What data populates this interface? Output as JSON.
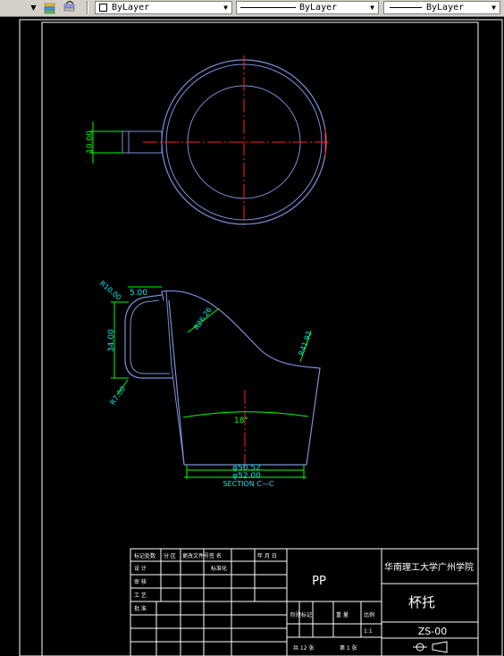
{
  "toolbar": {
    "layer_dropdown_label": "ByLayer",
    "linetype_dropdown_label": "ByLayer",
    "lineweight_dropdown_label": "ByLayer",
    "icons": [
      "dropdown-arrow-icon",
      "layer-states-icon",
      "layer-previous-icon"
    ]
  },
  "drawing": {
    "dim_handle_width": "10.00",
    "dim_radius_top": "R10.00",
    "dim_top_width": "5.00",
    "dim_height": "34.00",
    "dim_radius_bottom": "R7.00",
    "dim_radius_curve": "R26.26",
    "dim_radius_right": "R41.92",
    "dim_angle": "18°",
    "dim_inner_dia": "φ50.52",
    "dim_outer_dia": "φ52.00",
    "section_label": "SECTION C—C"
  },
  "title_block": {
    "material": "PP",
    "school": "华南理工大学广州学院",
    "part_name": "杯托",
    "drawing_no": "ZS-00",
    "scale": "1:1",
    "sheet_total": "共 12 张",
    "sheet_no": "第 1 张",
    "header_cells": [
      "标记处数",
      "分 区",
      "更改文件号",
      "签 名",
      "年 月 日"
    ],
    "row_labels": [
      "设 计",
      "审 核",
      "工 艺",
      "批 准"
    ],
    "std_label": "标准化",
    "stage_label": "阶段标记",
    "weight_label": "重 量",
    "scale_label": "比例"
  },
  "colors": {
    "outline": "#7b8fd6",
    "centerline": "#ff2020",
    "dimension": "#00ff00",
    "dim_text": "#00e8e8",
    "border": "#ffffff"
  }
}
